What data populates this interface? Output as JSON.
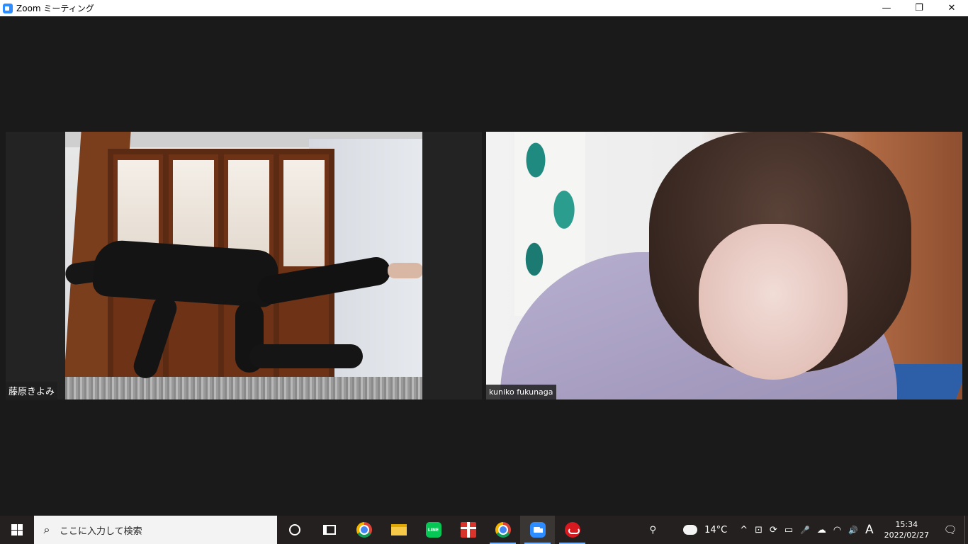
{
  "window": {
    "title": "Zoom ミーティング",
    "minimize_glyph": "—",
    "restore_glyph": "❐",
    "close_glyph": "✕"
  },
  "participants": [
    {
      "name": "藤原きよみ"
    },
    {
      "name": "kuniko fukunaga"
    }
  ],
  "taskbar": {
    "search_placeholder": "ここに入力して検索",
    "search_glyph": "⌕",
    "line_label": "LINE",
    "people_glyph": "⚲",
    "weather": "14°C",
    "chevron_glyph": "^",
    "meet_glyph": "⊡",
    "update_glyph": "⟳",
    "battery_glyph": "▭",
    "mic_glyph": "🎤",
    "cloud_glyph": "☁",
    "wifi_glyph": "◠",
    "volume_glyph": "🔊",
    "ime": "A",
    "time": "15:34",
    "date": "2022/02/27",
    "notification_glyph": "🗨"
  }
}
